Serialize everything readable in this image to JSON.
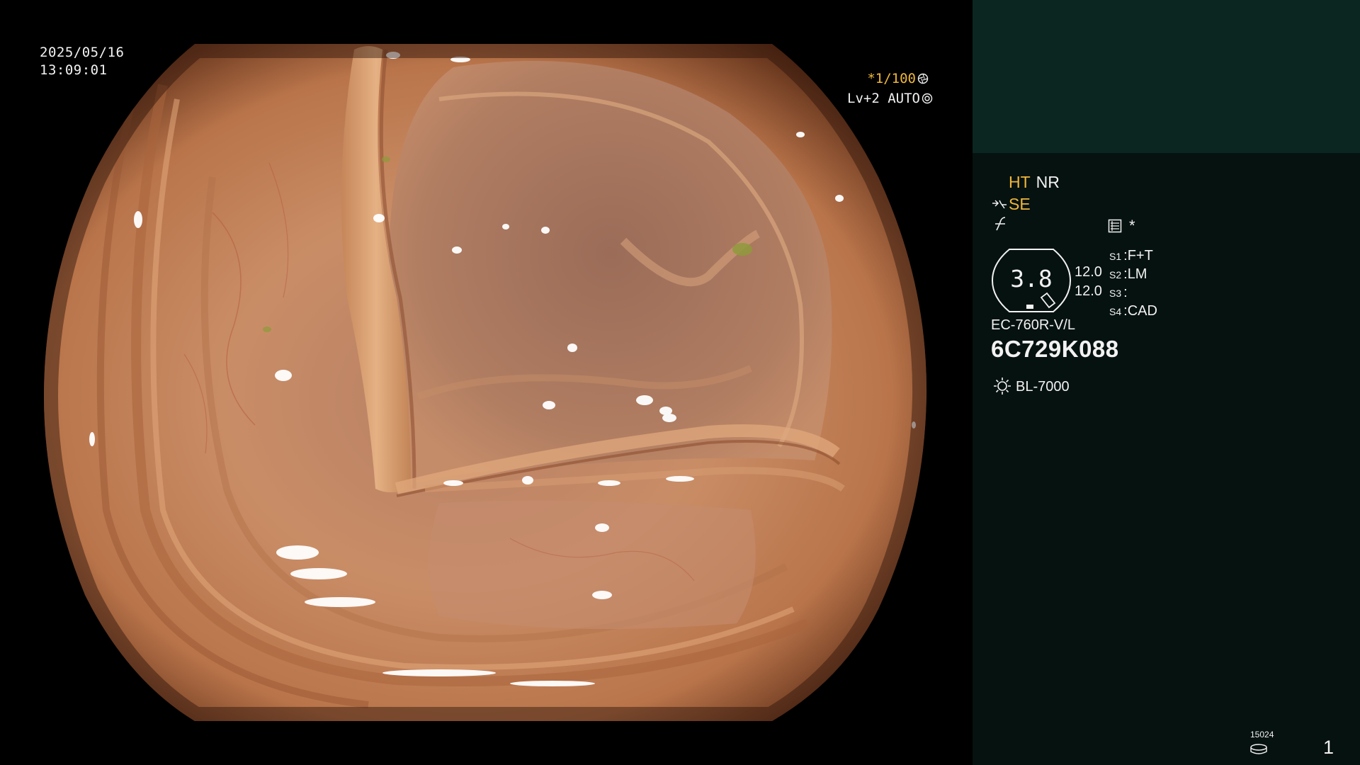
{
  "overlay": {
    "date": "2025/05/16",
    "time": "13:09:01",
    "shutter_star": "*",
    "shutter_speed": "1/100",
    "iris_level": "Lv+2",
    "iris_mode": "AUTO"
  },
  "panel": {
    "ht": "HT",
    "nr": "NR",
    "se": "SE",
    "indicator_star": "*",
    "magnification": "3.8",
    "zoom_values": [
      "12.0",
      "12.0"
    ],
    "switches": [
      {
        "key": "S1",
        "value": "F+T"
      },
      {
        "key": "S2",
        "value": "LM"
      },
      {
        "key": "S3",
        "value": ""
      },
      {
        "key": "S4",
        "value": "CAD"
      }
    ],
    "scope_model": "EC-760R-V/L",
    "scope_serial": "6C729K088",
    "light_source": "BL-7000",
    "disk_label": "15024",
    "page_number": "1"
  },
  "colors": {
    "accent": "#f0b73a",
    "panel_top": "#0b2621",
    "panel_bottom": "#061210",
    "mucosa": "#c8875a"
  },
  "icons": {
    "shutter": "aperture-icon",
    "iris": "iris-icon",
    "freeze": "freeze-icon",
    "structure": "structure-icon",
    "light": "light-bulb-icon",
    "disk": "disk-icon"
  }
}
